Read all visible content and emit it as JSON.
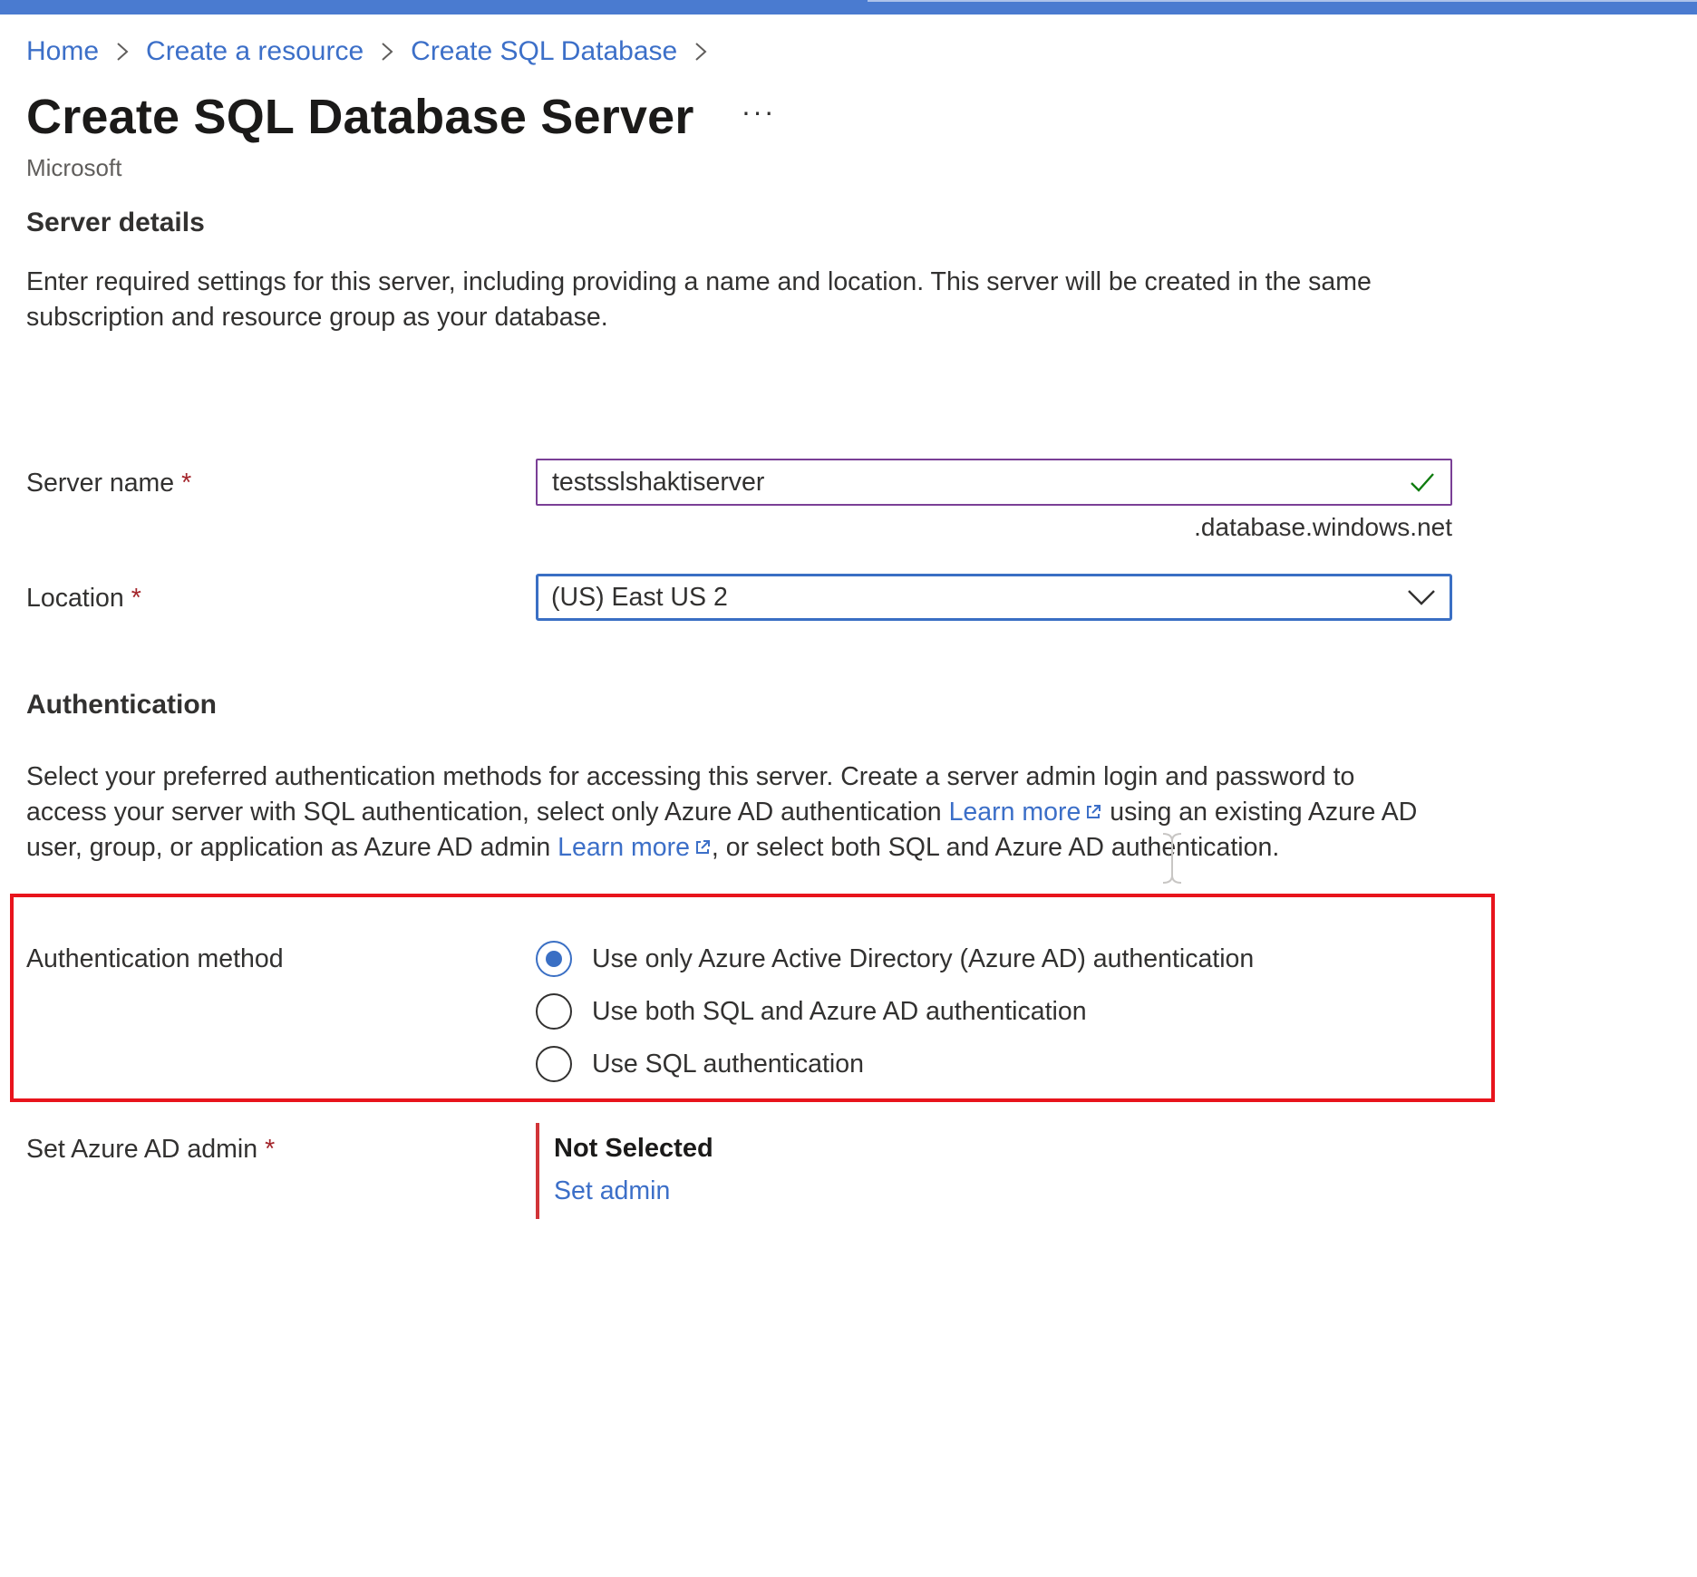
{
  "colors": {
    "brand_bar": "#4a7bd0",
    "link": "#3c6fc8",
    "required": "#a4262c",
    "focus_border": "#3a6fc4",
    "valid_border": "#7a3f96",
    "valid_check": "#107c10",
    "highlight": "#e8141c",
    "admin_bar": "#d13438"
  },
  "breadcrumb": [
    "Home",
    "Create a resource",
    "Create SQL Database"
  ],
  "header": {
    "title": "Create SQL Database Server",
    "more": "···",
    "publisher": "Microsoft"
  },
  "server_details": {
    "heading": "Server details",
    "description": "Enter required settings for this server, including providing a name and location. This server will be created in the same subscription and resource group as your database.",
    "server_name": {
      "label": "Server name",
      "required_mark": "*",
      "value": "testsslshaktiserver",
      "suffix": ".database.windows.net",
      "status_icon": "check-icon"
    },
    "location": {
      "label": "Location",
      "required_mark": "*",
      "value": "(US) East US 2",
      "icon": "chevron-down-icon"
    }
  },
  "authentication": {
    "heading": "Authentication",
    "description_part1": "Select your preferred authentication methods for accessing this server. Create a server admin login and password to access your server with SQL authentication, select only Azure AD authentication ",
    "learn_more_1": "Learn more",
    "description_part2": " using an existing Azure AD user, group, or application as Azure AD admin ",
    "learn_more_2": "Learn more",
    "description_part3": ", or select both SQL and Azure AD authentication.",
    "method": {
      "label": "Authentication method",
      "options": [
        "Use only Azure Active Directory (Azure AD) authentication",
        "Use both SQL and Azure AD authentication",
        "Use SQL authentication"
      ],
      "selected": "Use only Azure Active Directory (Azure AD) authentication"
    },
    "admin": {
      "label": "Set Azure AD admin",
      "required_mark": "*",
      "status": "Not Selected",
      "action": "Set admin"
    }
  }
}
